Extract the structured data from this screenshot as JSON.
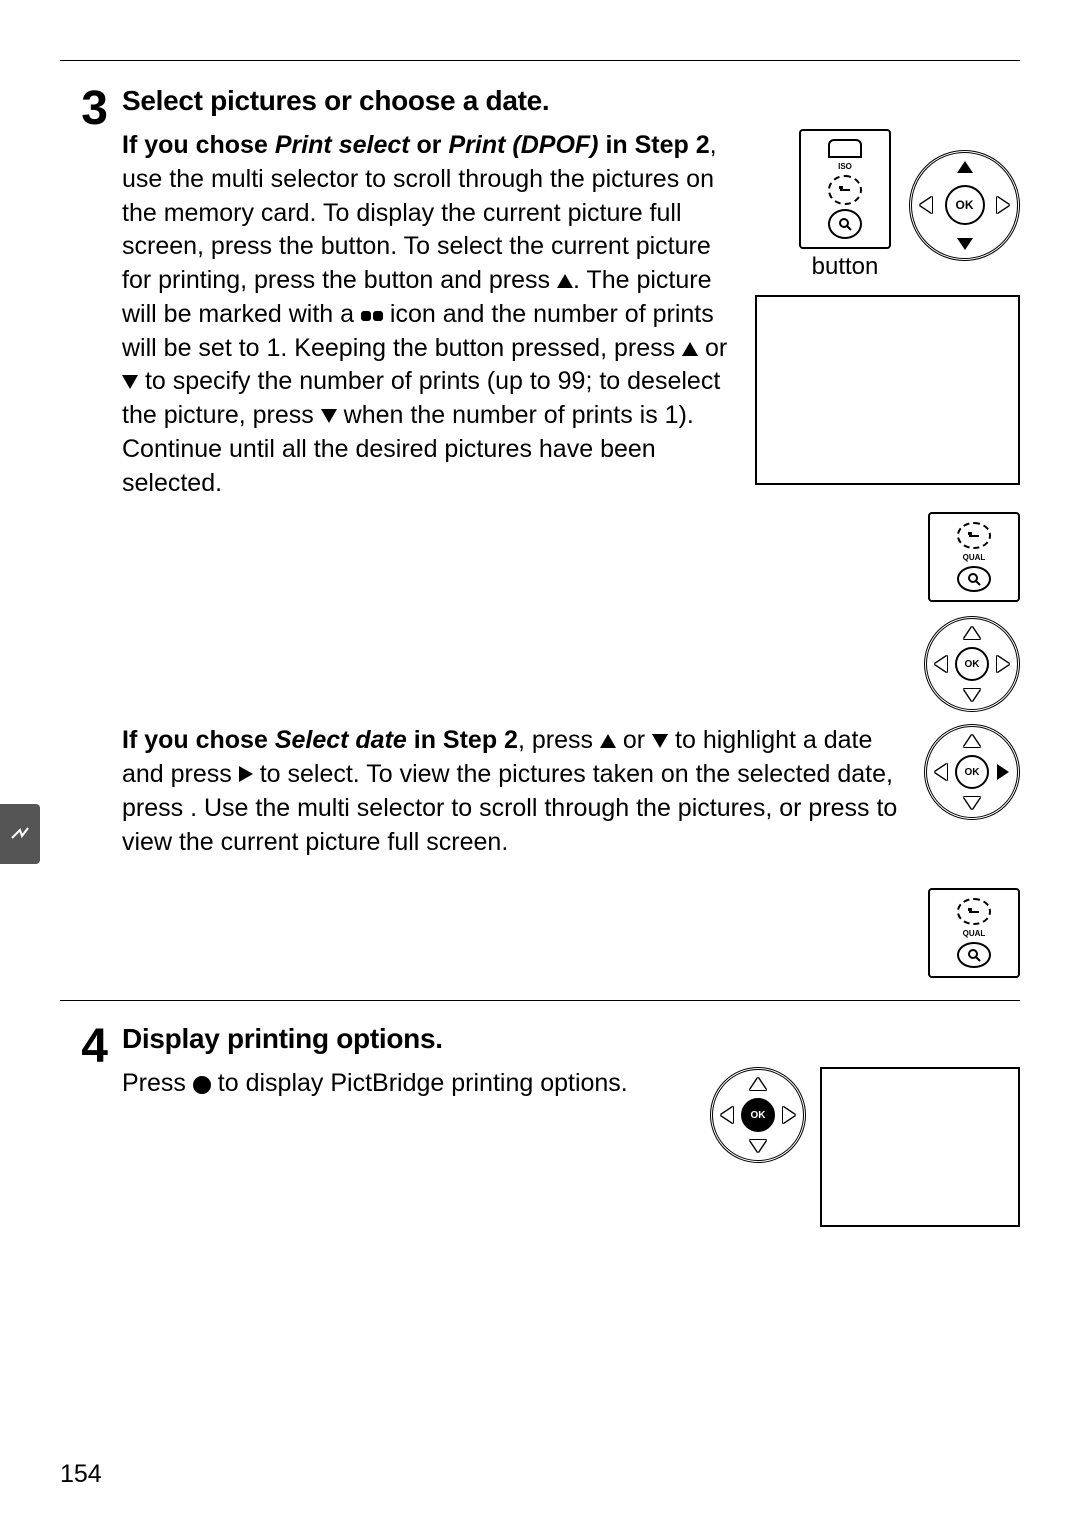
{
  "page_number": "154",
  "step3": {
    "num": "3",
    "title": "Select pictures or choose a date.",
    "para1": {
      "a": "If you chose ",
      "b": "Print select",
      "c": " or ",
      "d": "Print (DPOF)",
      "e": " in Step 2",
      "f": ", use the multi selector to scroll through the pictures on the memory card.  To display the current picture full screen, press the       button.  To select the current picture for printing, press the       button and press ",
      "g": ".  The picture will be marked with a ",
      "h": " icon and the number of prints will be set to 1.  Keeping the       button pressed, press ",
      "i": " or ",
      "j": " to specify the number of prints (up to 99; to deselect the picture, press ",
      "k": " when the number of prints is 1).  Continue until all the desired pictures have been selected."
    },
    "para2": {
      "a": "If you chose ",
      "b": "Select date",
      "c": " in Step 2",
      "d": ", press ",
      "e": " or ",
      "f": " to highlight a date and press ",
      "g": " to select.  To view the pictures taken on the selected date, press       .  Use the multi selector to scroll through the pictures, or press       to view the current picture full screen."
    },
    "caption": "button",
    "iso_label": "ISO",
    "qual_label": "QUAL",
    "ok_label": "OK"
  },
  "step4": {
    "num": "4",
    "title": "Display printing options.",
    "para": {
      "a": "Press ",
      "b": " to display PictBridge printing options."
    },
    "ok_label": "OK"
  }
}
